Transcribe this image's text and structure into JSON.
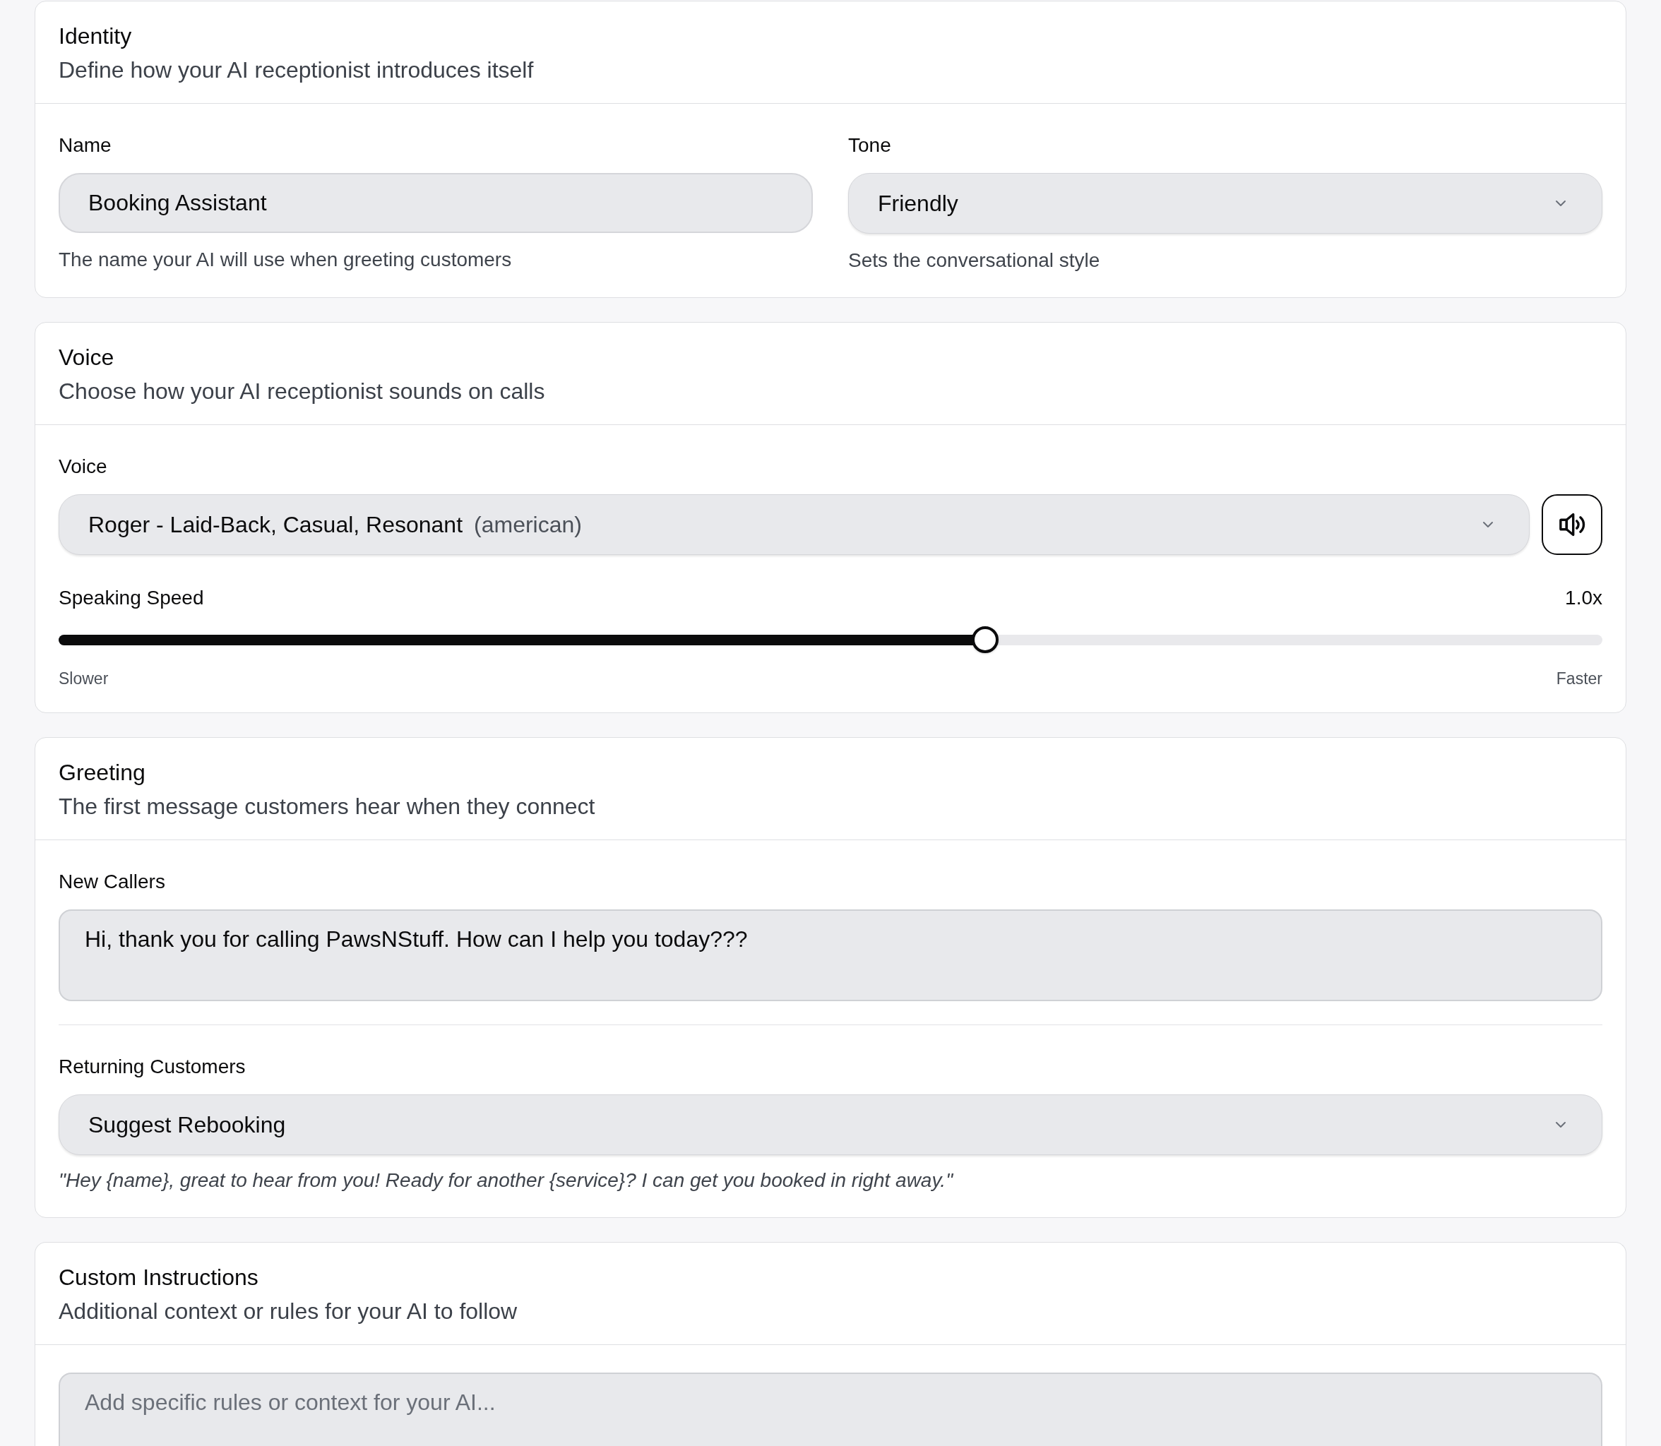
{
  "sections": [
    {
      "title": "Identity",
      "subtitle": "Define how your AI receptionist introduces itself",
      "side_by_side": true,
      "fields": [
        {
          "kind": "text",
          "label": "Name",
          "value": "Booking Assistant",
          "help": "The name your AI will use when greeting customers"
        },
        {
          "kind": "select",
          "label": "Tone",
          "value": "Friendly",
          "help": "Sets the conversational style"
        }
      ]
    },
    {
      "title": "Voice",
      "subtitle": "Choose how your AI receptionist sounds on calls",
      "fields": [
        {
          "kind": "voice_select",
          "label": "Voice",
          "value": "Roger - Laid-Back, Casual, Resonant",
          "accent": "(american)"
        },
        {
          "kind": "slider",
          "label": "Speaking Speed",
          "reading": "1.0x",
          "level": 0.6,
          "min_label": "Slower",
          "max_label": "Faster"
        }
      ]
    },
    {
      "title": "Greeting",
      "subtitle": "The first message customers hear when they connect",
      "divided": true,
      "fields": [
        {
          "kind": "textarea",
          "label": "New Callers",
          "value": "Hi, thank you for calling PawsNStuff. How can I help you today???"
        },
        {
          "kind": "select",
          "label": "Returning Customers",
          "value": "Suggest Rebooking",
          "example": "\"Hey {name}, great to hear from you! Ready for another {service}? I can get you booked in right away.\""
        }
      ]
    },
    {
      "title": "Custom Instructions",
      "subtitle": "Additional context or rules for your AI to follow",
      "fields": [
        {
          "kind": "textarea",
          "placeholder": "Add specific rules or context for your AI..."
        }
      ]
    }
  ]
}
